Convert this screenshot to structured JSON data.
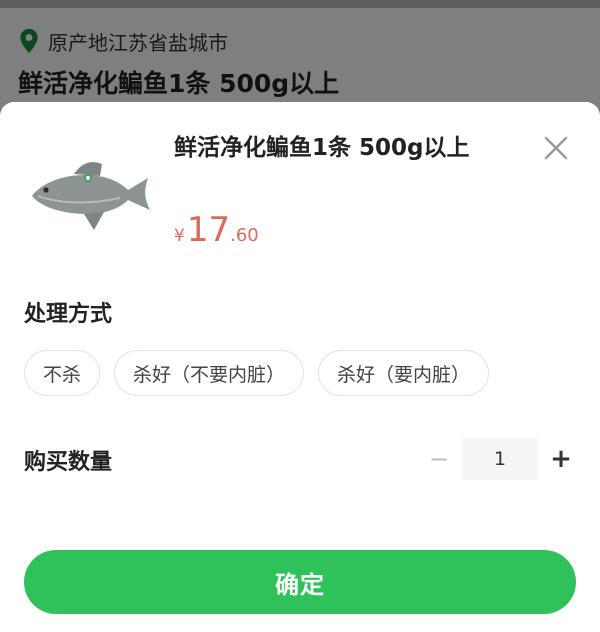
{
  "background": {
    "origin_text": "原产地江苏省盐城市",
    "title": "鲜活净化鳊鱼1条 500g以上"
  },
  "sheet": {
    "product_name": "鲜活净化鳊鱼1条 500g以上",
    "price": {
      "currency": "¥",
      "integer": "17",
      "decimal": ".60",
      "color": "#e0675c"
    },
    "processing": {
      "label": "处理方式",
      "options": [
        "不杀",
        "杀好（不要内脏）",
        "杀好（要内脏）"
      ]
    },
    "quantity": {
      "label": "购买数量",
      "minus": "−",
      "value": "1",
      "plus": "+"
    },
    "confirm_label": "确定",
    "accent_color": "#2fc25a"
  }
}
